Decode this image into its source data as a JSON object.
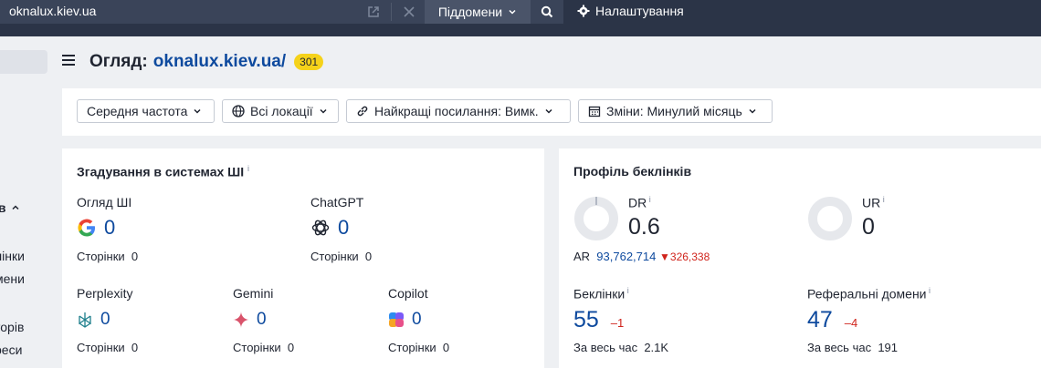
{
  "topbar": {
    "url": "oknalux.kiev.ua",
    "subdomains_label": "Піддомени",
    "settings_label": "Налаштування"
  },
  "sidebar": {
    "items": [
      "ів",
      "лінки",
      "мени",
      "торів",
      "реси"
    ]
  },
  "header": {
    "title_prefix": "Огляд:",
    "domain": "oknalux.kiev.ua/",
    "badge": "301"
  },
  "filters": {
    "volume": "Середня частота",
    "locations": "Всі локації",
    "best_links": "Найкращі посилання: Вимк.",
    "changes": "Зміни: Минулий місяць"
  },
  "ai_card": {
    "title": "Згадування в системах ШІ",
    "info": "i",
    "pages_label": "Сторінки",
    "items": [
      {
        "label": "Огляд ШІ",
        "value": "0",
        "pages": "0"
      },
      {
        "label": "ChatGPT",
        "value": "0",
        "pages": "0"
      },
      {
        "label": "Perplexity",
        "value": "0",
        "pages": "0"
      },
      {
        "label": "Gemini",
        "value": "0",
        "pages": "0"
      },
      {
        "label": "Copilot",
        "value": "0",
        "pages": "0"
      }
    ]
  },
  "backlink_card": {
    "title": "Профіль беклінків",
    "dr_label": "DR",
    "dr_value": "0.6",
    "ur_label": "UR",
    "ur_value": "0",
    "ar_label": "AR",
    "ar_value": "93,762,714",
    "ar_delta": "326,338",
    "backlinks_label": "Беклінки",
    "backlinks_value": "55",
    "backlinks_delta": "–1",
    "backlinks_all_label": "За весь час",
    "backlinks_all_value": "2.1K",
    "refdomains_label": "Реферальні домени",
    "refdomains_value": "47",
    "refdomains_delta": "–4",
    "refdomains_all_label": "За весь час",
    "refdomains_all_value": "191"
  },
  "colors": {
    "topbar": "#2b3447",
    "accent_blue": "#0e4a9e",
    "badge_yellow": "#f5d21a",
    "negative_red": "#d0241c"
  }
}
